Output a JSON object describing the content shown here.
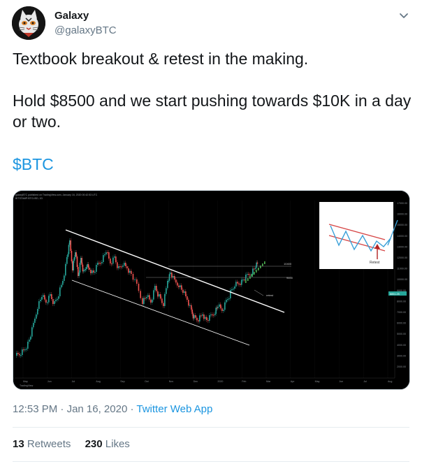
{
  "user": {
    "display_name": "Galaxy",
    "handle": "@galaxyBTC",
    "avatar_icon": "cat-avatar-icon"
  },
  "menu_icon": "chevron-down-icon",
  "tweet": {
    "line1": "Textbook breakout & retest in the making.",
    "line2": "Hold $8500 and we start pushing towards $10K in a day",
    "line3": "or two.",
    "cashtag": "$BTC"
  },
  "chart": {
    "header_line1": "galaxyBTC published on TradingView.com, January 16, 2020 00:42:53 UTC",
    "header_line2": "BITSTAMP:BTCUSD, 1D",
    "level_upper": "10400",
    "level_lower": "9400",
    "retest_note": "retest",
    "inset_label": "Retest",
    "price_ticks": [
      "17000.00",
      "16000.00",
      "15000.00",
      "14000.00",
      "13000.00",
      "12000.00",
      "11000.00",
      "10000.00",
      "9000.00",
      "8000.00",
      "7000.00",
      "6000.00",
      "5000.00",
      "4000.00",
      "3000.00",
      "2000.00"
    ],
    "current_price": "8851.25",
    "months": [
      "May",
      "Jun",
      "Jul",
      "Aug",
      "Sep",
      "Oct",
      "Nov",
      "Dec",
      "2020",
      "Feb",
      "Mar",
      "Apr",
      "May",
      "Jun",
      "Jul",
      "Aug"
    ],
    "watermark": "TradingView"
  },
  "meta": {
    "time": "12:53 PM",
    "sep1": "·",
    "date": "Jan 16, 2020",
    "sep2": "·",
    "app": "Twitter Web App"
  },
  "stats": {
    "retweets_count": "13",
    "retweets_label": "Retweets",
    "likes_count": "230",
    "likes_label": "Likes"
  },
  "colors": {
    "link": "#1b95e0",
    "muted": "#657786",
    "candle_up": "#26a69a",
    "candle_down": "#ef5350"
  }
}
